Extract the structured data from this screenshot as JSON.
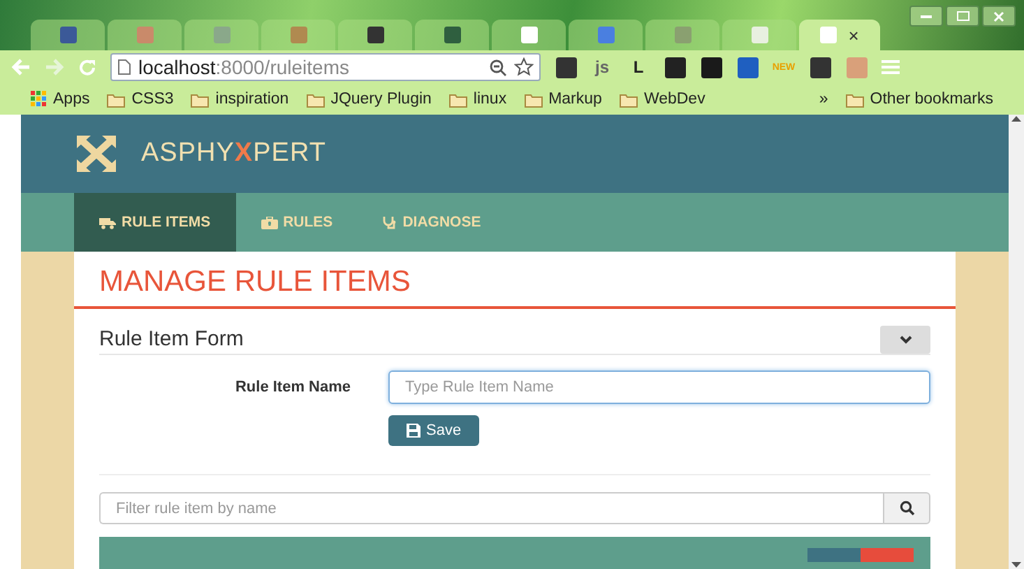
{
  "browser": {
    "tabs": [
      {
        "selected": false,
        "color": "#3b5998"
      },
      {
        "selected": false,
        "color": "#c98a6a"
      },
      {
        "selected": false,
        "color": "#8aa88a"
      },
      {
        "selected": false,
        "color": "#b08a50"
      },
      {
        "selected": false,
        "color": "#333333"
      },
      {
        "selected": false,
        "color": "#2f5f3f"
      },
      {
        "selected": false,
        "color": "#ffffff"
      },
      {
        "selected": false,
        "color": "#4a7fe0"
      },
      {
        "selected": false,
        "color": "#8aa070"
      },
      {
        "selected": false,
        "color": "#e8f0e0"
      },
      {
        "selected": true,
        "color": "#ffffff"
      }
    ],
    "close_tab": "×",
    "url_host": "localhost",
    "url_path": ":8000/ruleitems",
    "extensions": [
      {
        "kind": "icon",
        "color": "#333333"
      },
      {
        "kind": "text",
        "label": "js",
        "color": "#666666"
      },
      {
        "kind": "text",
        "label": "L",
        "color": "#222222"
      },
      {
        "kind": "icon",
        "color": "#222222"
      },
      {
        "kind": "icon",
        "color": "#1a1a1a"
      },
      {
        "kind": "icon",
        "color": "#1f5fc0"
      },
      {
        "kind": "text",
        "label": "NEW",
        "color": "#e8a000"
      },
      {
        "kind": "icon",
        "color": "#333333"
      },
      {
        "kind": "icon",
        "color": "#d9a07a"
      }
    ],
    "bookmarks": [
      {
        "kind": "apps",
        "label": "Apps"
      },
      {
        "kind": "folder",
        "label": "CSS3"
      },
      {
        "kind": "folder",
        "label": "inspiration"
      },
      {
        "kind": "folder",
        "label": "JQuery Plugin"
      },
      {
        "kind": "folder",
        "label": "linux"
      },
      {
        "kind": "folder",
        "label": "Markup"
      },
      {
        "kind": "folder",
        "label": "WebDev"
      }
    ],
    "more_bookmarks": "»",
    "other_bookmarks": "Other bookmarks"
  },
  "brand": {
    "prefix": "ASPHY",
    "accent": "X",
    "suffix": "PERT"
  },
  "nav": [
    {
      "label": "RULE ITEMS",
      "selected": true
    },
    {
      "label": "RULES",
      "selected": false
    },
    {
      "label": "DIAGNOSE",
      "selected": false
    }
  ],
  "page_title": "MANAGE RULE ITEMS",
  "form": {
    "title": "Rule Item Form",
    "expanded": true,
    "field_label": "Rule Item Name",
    "placeholder": "Type Rule Item Name",
    "save": "Save"
  },
  "filter": {
    "placeholder": "Filter rule item by name"
  }
}
